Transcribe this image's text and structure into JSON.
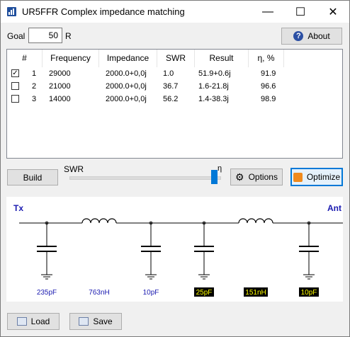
{
  "window": {
    "title": "UR5FFR Complex impedance matching",
    "min_glyph": "—",
    "max_glyph": "☐",
    "close_glyph": "✕",
    "icon": "bar-chart-icon"
  },
  "goal": {
    "label": "Goal",
    "value": "50",
    "unit": "R"
  },
  "about_button": {
    "label": "About",
    "icon": "help-icon"
  },
  "table": {
    "columns": [
      "#",
      "Frequency",
      "Impedance",
      "SWR",
      "Result",
      "η, %"
    ],
    "rows": [
      {
        "checked": true,
        "index": "1",
        "frequency": "29000",
        "impedance": "2000.0+0,0j",
        "swr": "1.0",
        "result": "51.9+0.6j",
        "eta": "91.9"
      },
      {
        "checked": false,
        "index": "2",
        "frequency": "21000",
        "impedance": "2000.0+0,0j",
        "swr": "36.7",
        "result": "1.6-21.8j",
        "eta": "96.6"
      },
      {
        "checked": false,
        "index": "3",
        "frequency": "14000",
        "impedance": "2000.0+0,0j",
        "swr": "56.2",
        "result": "1.4-38.3j",
        "eta": "98.9"
      }
    ]
  },
  "controls": {
    "build_label": "Build",
    "slider_left_label": "SWR",
    "slider_right_label": "η",
    "slider_value": 0.97,
    "options_label": "Options",
    "optimize_label": "Optimize"
  },
  "schematic": {
    "tx_label": "Tx",
    "ant_label": "Ant",
    "components": [
      {
        "type": "capacitor-shunt",
        "label": "235pF",
        "highlight": false
      },
      {
        "type": "inductor-series",
        "label": "763nH",
        "highlight": false
      },
      {
        "type": "capacitor-shunt",
        "label": "10pF",
        "highlight": false
      },
      {
        "type": "capacitor-shunt",
        "label": "25pF",
        "highlight": true
      },
      {
        "type": "inductor-series",
        "label": "151nH",
        "highlight": true
      },
      {
        "type": "capacitor-shunt",
        "label": "10pF",
        "highlight": true
      }
    ],
    "colors": {
      "label": "#1a1ab0",
      "highlight_bg": "#000000",
      "highlight_fg": "#ffff00"
    }
  },
  "footer": {
    "load_label": "Load",
    "save_label": "Save"
  }
}
